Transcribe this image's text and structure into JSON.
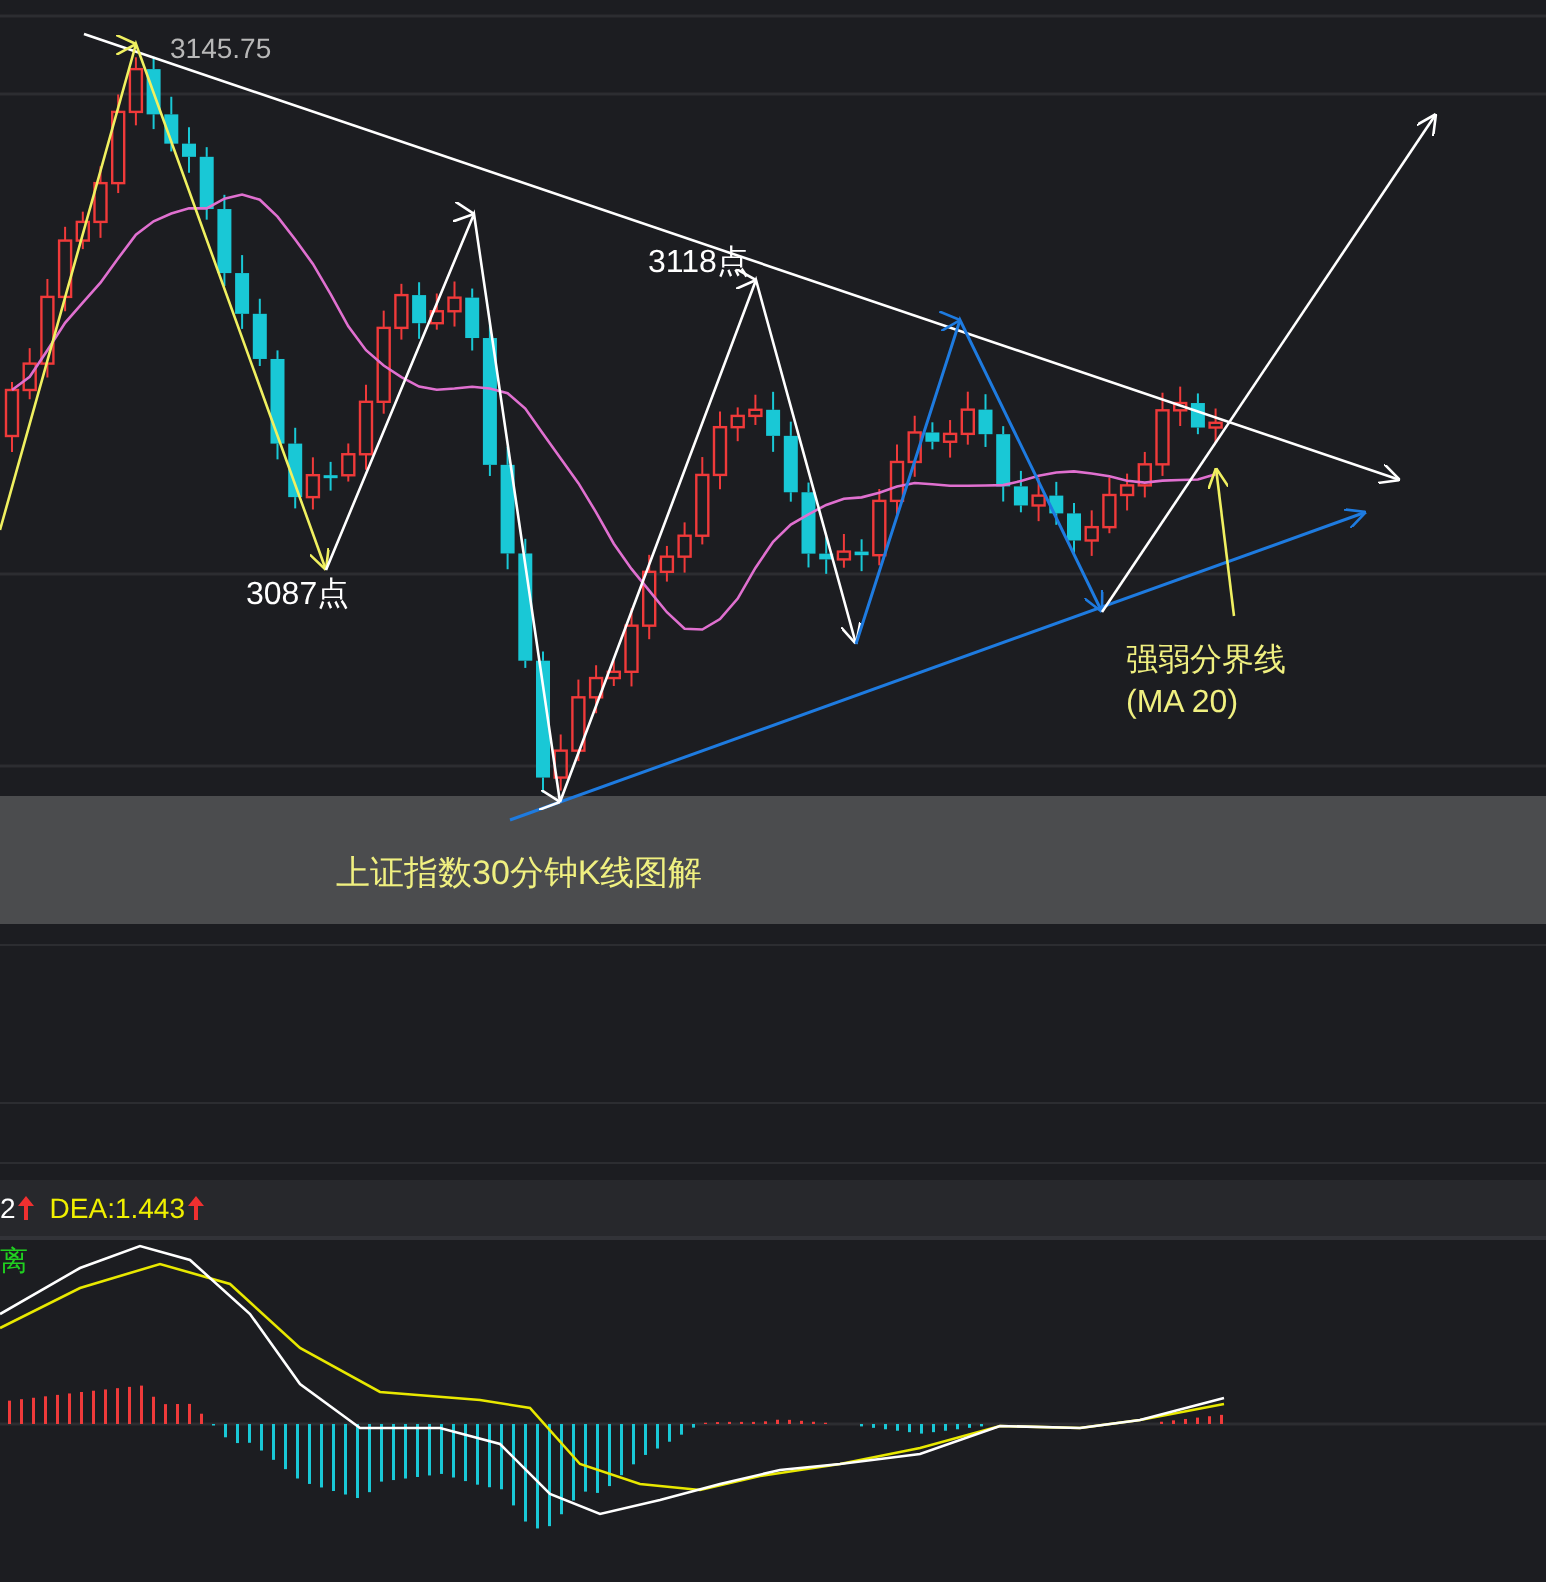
{
  "main_chart": {
    "high_label": "3145.75",
    "labels": [
      {
        "text": "3118点"
      },
      {
        "text": "3087点"
      }
    ],
    "ma_note": {
      "title": "强弱分界线",
      "subtitle": "(MA 20)"
    }
  },
  "caption": "上证指数30分钟K线图解",
  "macd": {
    "indicators": [
      {
        "text": "2",
        "color": "#ffffff",
        "rising": true
      },
      {
        "text": "DEA:1.443",
        "color": "#f0f000",
        "rising": true
      }
    ],
    "divergence_label": "离"
  }
}
